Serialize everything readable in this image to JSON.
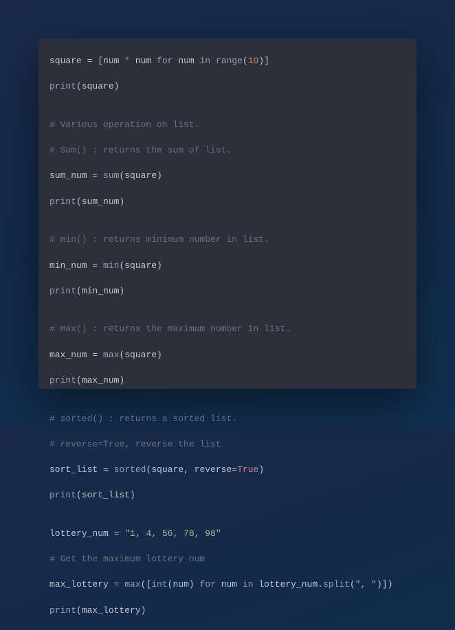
{
  "code": {
    "l1": {
      "a": "square ",
      "b": "=",
      "c": " [num ",
      "d": "*",
      "e": " num ",
      "f": "for",
      "g": " num ",
      "h": "in",
      "i": " ",
      "j": "range",
      "k": "(",
      "l": "10",
      "m": ")]"
    },
    "l2": {
      "a": "print",
      "b": "(square)"
    },
    "l3": {
      "a": ""
    },
    "l4": {
      "a": "# Various operation on list."
    },
    "l5": {
      "a": "# Sum() : returns the sum of list."
    },
    "l6": {
      "a": "sum_num ",
      "b": "=",
      "c": " ",
      "d": "sum",
      "e": "(square)"
    },
    "l7": {
      "a": "print",
      "b": "(sum_num)"
    },
    "l8": {
      "a": ""
    },
    "l9": {
      "a": "# min() : returns minimum number in list."
    },
    "l10": {
      "a": "min_num ",
      "b": "=",
      "c": " ",
      "d": "min",
      "e": "(square)"
    },
    "l11": {
      "a": "print",
      "b": "(min_num)"
    },
    "l12": {
      "a": ""
    },
    "l13": {
      "a": "# max() : returns the maximum number in list."
    },
    "l14": {
      "a": "max_num ",
      "b": "=",
      "c": " ",
      "d": "max",
      "e": "(square)"
    },
    "l15": {
      "a": "print",
      "b": "(max_num)"
    },
    "l16": {
      "a": ""
    },
    "l17": {
      "a": "# sorted() : returns a sorted list."
    },
    "l18": {
      "a": "# reverse=True, reverse the list"
    },
    "l19": {
      "a": "sort_list ",
      "b": "=",
      "c": " ",
      "d": "sorted",
      "e": "(square, reverse",
      "f": "=",
      "g": "True",
      "h": ")"
    },
    "l20": {
      "a": "print",
      "b": "(sort_list)"
    },
    "l21": {
      "a": ""
    },
    "l22": {
      "a": "lottery_num ",
      "b": "=",
      "c": " ",
      "d": "\"1, 4, 56, 78, 98\""
    },
    "l23": {
      "a": "# Get the maximum lottery num"
    },
    "l24": {
      "a": "max_lottery ",
      "b": "=",
      "c": " ",
      "d": "max",
      "e": "([",
      "f": "int",
      "g": "(num) ",
      "h": "for",
      "i": " num ",
      "j": "in",
      "k": " lottery_num.",
      "l": "split",
      "m": "(",
      "n": "\", \"",
      "o": ")])"
    },
    "l25": {
      "a": "print",
      "b": "(max_lottery)"
    }
  }
}
